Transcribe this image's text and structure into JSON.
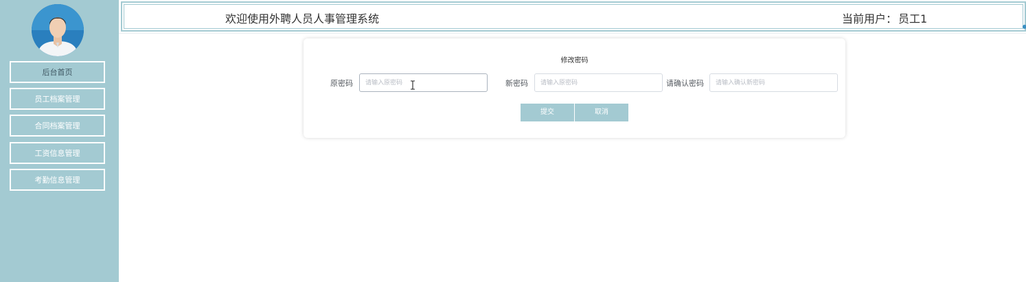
{
  "sidebar": {
    "items": [
      {
        "label": "后台首页",
        "active": true
      },
      {
        "label": "员工档案管理"
      },
      {
        "label": "合同档案管理"
      },
      {
        "label": "工资信息管理"
      },
      {
        "label": "考勤信息管理"
      }
    ]
  },
  "header": {
    "title": "欢迎使用外聘人员人事管理系统",
    "user_prefix": "当前用户：",
    "user_name": "员工1"
  },
  "form": {
    "title": "修改密码",
    "fields": [
      {
        "label": "原密码",
        "placeholder": "请输入原密码",
        "value": ""
      },
      {
        "label": "新密码",
        "placeholder": "请输入原密码",
        "value": ""
      },
      {
        "label": "请确认密码",
        "placeholder": "请输入确认新密码",
        "value": ""
      }
    ],
    "submit_label": "提交",
    "cancel_label": "取消"
  },
  "colors": {
    "sidebar_bg": "#a3cad2",
    "accent": "#a3cad2",
    "text": "#333333"
  },
  "icons": {
    "avatar": "user-photo",
    "cursor": "text-cursor-icon"
  }
}
